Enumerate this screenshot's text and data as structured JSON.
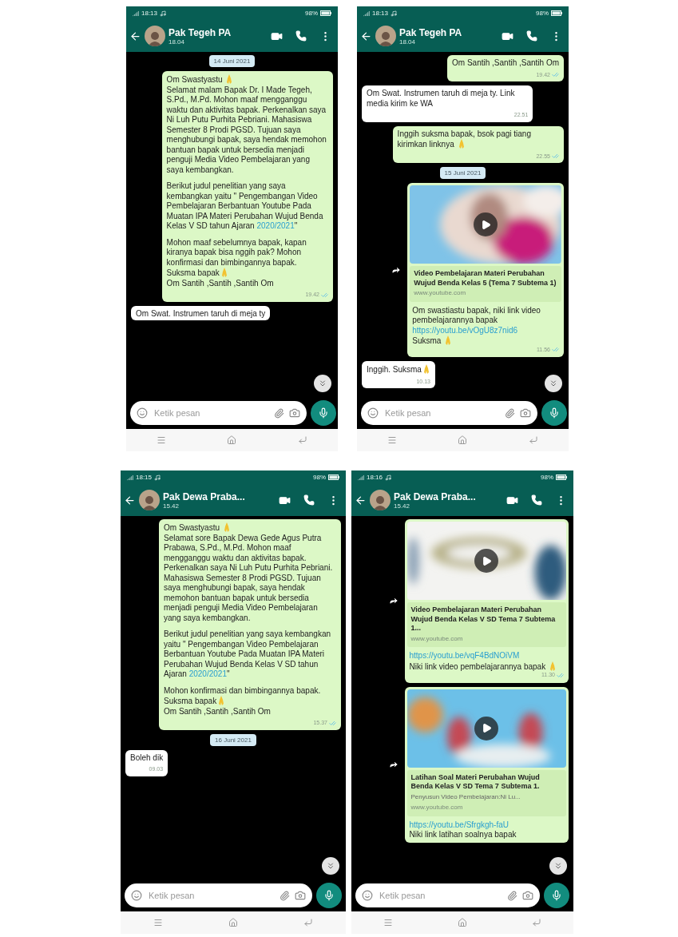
{
  "screens": [
    {
      "status": {
        "time": "18:13",
        "battery": "98%"
      },
      "contact": {
        "name": "Pak Tegeh PA",
        "last_seen": "18.04"
      },
      "messages": [
        {
          "kind": "date",
          "text": "14 Juni 2021"
        },
        {
          "kind": "out",
          "time": "19.42",
          "blocks": [
            [
              [
                {
                  "kind": "text",
                  "text": "Om Swastyastu "
                },
                {
                  "kind": "emoji"
                }
              ],
              [
                {
                  "kind": "text",
                  "text": "Selamat malam Bapak Dr. I Made Tegeh, S.Pd., M.Pd. Mohon maaf mengganggu waktu dan aktivitas bapak. Perkenalkan saya Ni Luh Putu Purhita Pebriani. Mahasiswa Semester 8 Prodi PGSD. Tujuan saya menghubungi bapak, saya hendak memohon bantuan bapak untuk bersedia menjadi penguji Media Video Pembelajaran yang saya kembangkan."
                }
              ]
            ],
            [
              [
                {
                  "kind": "text",
                  "text": "Berikut judul penelitian yang saya kembangkan yaitu \" Pengembangan Video Pembelajaran Berbantuan Youtube Pada Muatan IPA Materi Perubahan Wujud Benda Kelas V SD tahun Ajaran "
                },
                {
                  "kind": "link",
                  "text": "2020/2021"
                },
                {
                  "kind": "text",
                  "text": "\""
                }
              ]
            ],
            [
              [
                {
                  "kind": "text",
                  "text": "Mohon maaf sebelumnya bapak, kapan kiranya bapak bisa nggih pak? Mohon konfirmasi dan bimbingannya bapak."
                }
              ],
              [
                {
                  "kind": "text",
                  "text": "Suksma bapak"
                },
                {
                  "kind": "emoji"
                }
              ],
              [
                {
                  "kind": "text",
                  "text": "Om Santih ,Santih ,Santih Om"
                }
              ]
            ]
          ]
        },
        {
          "kind": "in",
          "blocks": [
            [
              [
                {
                  "kind": "text",
                  "text": "Om Swat. Instrumen taruh di meja ty"
                }
              ]
            ]
          ]
        }
      ],
      "input": {
        "placeholder": "Ketik pesan"
      }
    },
    {
      "status": {
        "time": "18:13",
        "battery": "98%"
      },
      "contact": {
        "name": "Pak Tegeh PA",
        "last_seen": "18.04"
      },
      "messages": [
        {
          "kind": "out",
          "time": "19.42",
          "blocks": [
            [
              [
                {
                  "kind": "text",
                  "text": "Om Santih ,Santih ,Santih Om"
                }
              ]
            ]
          ]
        },
        {
          "kind": "in",
          "time": "22.51",
          "blocks": [
            [
              [
                {
                  "kind": "text",
                  "text": "Om Swat. Instrumen taruh di meja ty. Link media kirim ke WA"
                }
              ]
            ]
          ]
        },
        {
          "kind": "out",
          "time": "22.55",
          "blocks": [
            [
              [
                {
                  "kind": "text",
                  "text": "Inggih suksma bapak, bsok pagi tiang kirimkan linknya "
                },
                {
                  "kind": "emoji"
                }
              ]
            ]
          ]
        },
        {
          "kind": "date",
          "text": "15 Juni 2021"
        },
        {
          "kind": "link",
          "time": "11.56",
          "preview": {
            "title": "Video Pembelajaran Materi Perubahan Wujud Benda Kelas 5 (Tema 7 Subtema 1)",
            "site": "www.youtube.com"
          },
          "blocks": [
            [
              [
                {
                  "kind": "text",
                  "text": "Om swastiastu bapak, niki link video pembelajarannya bapak"
                }
              ],
              [
                {
                  "kind": "link",
                  "text": "https://youtu.be/vOgU8z7nid6"
                }
              ],
              [
                {
                  "kind": "text",
                  "text": "Suksma "
                },
                {
                  "kind": "emoji"
                }
              ]
            ]
          ]
        },
        {
          "kind": "in",
          "time": "10.13",
          "blocks": [
            [
              [
                {
                  "kind": "text",
                  "text": "Inggih. Suksma"
                },
                {
                  "kind": "emoji"
                }
              ]
            ]
          ]
        }
      ],
      "input": {
        "placeholder": "Ketik pesan"
      }
    },
    {
      "status": {
        "time": "18:15",
        "battery": "98%"
      },
      "contact": {
        "name": "Pak Dewa Praba...",
        "last_seen": "15.42"
      },
      "messages": [
        {
          "kind": "out",
          "time": "15.37",
          "blocks": [
            [
              [
                {
                  "kind": "text",
                  "text": "Om Swastyastu "
                },
                {
                  "kind": "emoji"
                }
              ],
              [
                {
                  "kind": "text",
                  "text": "Selamat sore Bapak Dewa Gede Agus Putra Prabawa, S.Pd., M.Pd. Mohon maaf mengganggu waktu dan aktivitas bapak. Perkenalkan saya Ni Luh Putu Purhita Pebriani. Mahasiswa Semester 8 Prodi PGSD. Tujuan saya menghubungi bapak, saya hendak memohon bantuan bapak untuk bersedia menjadi penguji Media Video Pembelajaran yang saya kembangkan."
                }
              ]
            ],
            [
              [
                {
                  "kind": "text",
                  "text": "Berikut judul penelitian yang saya kembangkan yaitu \" Pengembangan Video Pembelajaran Berbantuan Youtube Pada Muatan IPA Materi Perubahan Wujud Benda Kelas V SD tahun Ajaran "
                },
                {
                  "kind": "link",
                  "text": "2020/2021"
                },
                {
                  "kind": "text",
                  "text": "\""
                }
              ]
            ],
            [
              [
                {
                  "kind": "text",
                  "text": "Mohon konfirmasi dan bimbingannya bapak."
                }
              ],
              [
                {
                  "kind": "text",
                  "text": "Suksma bapak"
                },
                {
                  "kind": "emoji"
                }
              ],
              [
                {
                  "kind": "text",
                  "text": "Om Santih ,Santih ,Santih Om"
                }
              ]
            ]
          ]
        },
        {
          "kind": "date",
          "text": "16 Juni 2021"
        },
        {
          "kind": "in",
          "time": "09.03",
          "blocks": [
            [
              [
                {
                  "kind": "text",
                  "text": "Boleh dik"
                }
              ]
            ]
          ]
        }
      ],
      "input": {
        "placeholder": "Ketik pesan"
      }
    },
    {
      "status": {
        "time": "18:16",
        "battery": "98%"
      },
      "contact": {
        "name": "Pak Dewa Praba...",
        "last_seen": "15.42"
      },
      "messages": [
        {
          "kind": "link",
          "time": "11.30",
          "preview": {
            "title": "Video Pembelajaran Materi Perubahan Wujud Benda Kelas V SD Tema 7 Subtema 1...",
            "site": "www.youtube.com"
          },
          "blocks": [
            [
              [
                {
                  "kind": "link",
                  "text": "https://youtu.be/vqF4BdNOiVM"
                }
              ],
              [
                {
                  "kind": "text",
                  "text": "Niki link video pembelajarannya bapak "
                },
                {
                  "kind": "emoji"
                }
              ]
            ]
          ]
        },
        {
          "kind": "link",
          "preview": {
            "title": "Latihan Soal Materi Perubahan Wujud Benda Kelas V SD Tema 7 Subtema 1.",
            "description": "Penyusun Video Pembelajaran:Ni Lu...",
            "site": "www.youtube.com"
          },
          "blocks": [
            [
              [
                {
                  "kind": "link",
                  "text": "https://youtu.be/Sfrgkgh-faU"
                }
              ],
              [
                {
                  "kind": "text",
                  "text": "Niki link latihan soalnya bapak"
                }
              ]
            ]
          ]
        }
      ],
      "input": {
        "placeholder": "Ketik pesan"
      }
    }
  ]
}
